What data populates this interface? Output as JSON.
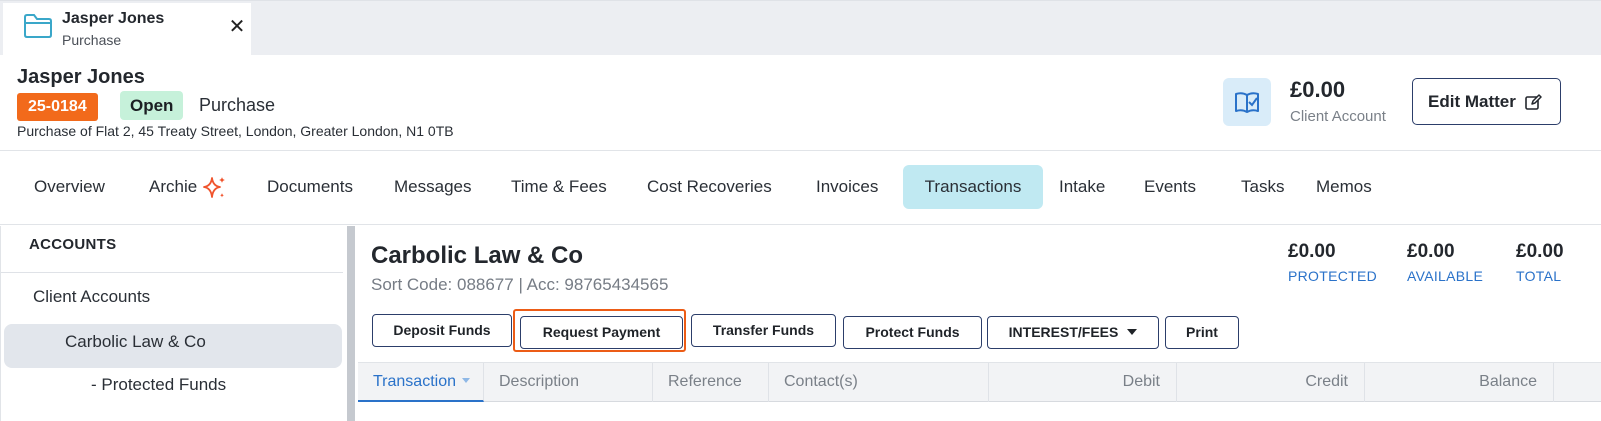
{
  "tab": {
    "title": "Jasper Jones",
    "subtitle": "Purchase",
    "close": "✕"
  },
  "matter": {
    "name": "Jasper Jones",
    "number": "25-0184",
    "status": "Open",
    "type": "Purchase",
    "address": "Purchase of Flat 2, 45 Treaty Street, London, Greater London, N1 0TB"
  },
  "client_account": {
    "amount": "£0.00",
    "label": "Client Account",
    "icon": "open-book-check-icon"
  },
  "edit_matter": {
    "label": "Edit Matter",
    "icon": "edit-icon"
  },
  "nav": {
    "overview": "Overview",
    "archie": "Archie",
    "documents": "Documents",
    "messages": "Messages",
    "time_fees": "Time & Fees",
    "cost_recoveries": "Cost Recoveries",
    "invoices": "Invoices",
    "transactions": "Transactions",
    "intake": "Intake",
    "events": "Events",
    "tasks": "Tasks",
    "memos": "Memos",
    "active": "Transactions"
  },
  "sidebar": {
    "heading": "ACCOUNTS",
    "items": [
      "Client Accounts",
      "Carbolic Law & Co",
      "- Protected Funds"
    ],
    "selected": "Carbolic Law & Co"
  },
  "account": {
    "name": "Carbolic Law & Co",
    "sort_code_acc": "Sort Code: 088677 | Acc: 98765434565",
    "balances": [
      {
        "amount": "£0.00",
        "label": "PROTECTED"
      },
      {
        "amount": "£0.00",
        "label": "AVAILABLE"
      },
      {
        "amount": "£0.00",
        "label": "TOTAL"
      }
    ]
  },
  "actions": {
    "deposit": "Deposit Funds",
    "request": "Request Payment",
    "transfer": "Transfer Funds",
    "protect": "Protect Funds",
    "interest": "INTEREST/FEES",
    "print": "Print",
    "highlighted": "Request Payment"
  },
  "table": {
    "columns": [
      "Transaction",
      "Description",
      "Reference",
      "Contact(s)",
      "Debit",
      "Credit",
      "Balance"
    ],
    "sorted_column": "Transaction"
  },
  "colors": {
    "accent": "#2a72c9",
    "matter_number_bg": "#f26a1b",
    "status_open_bg": "#c6f1da",
    "active_tab_bg": "#c0e9f2",
    "highlight_border": "#ec5c16",
    "archie_spark": "#f0542d"
  }
}
